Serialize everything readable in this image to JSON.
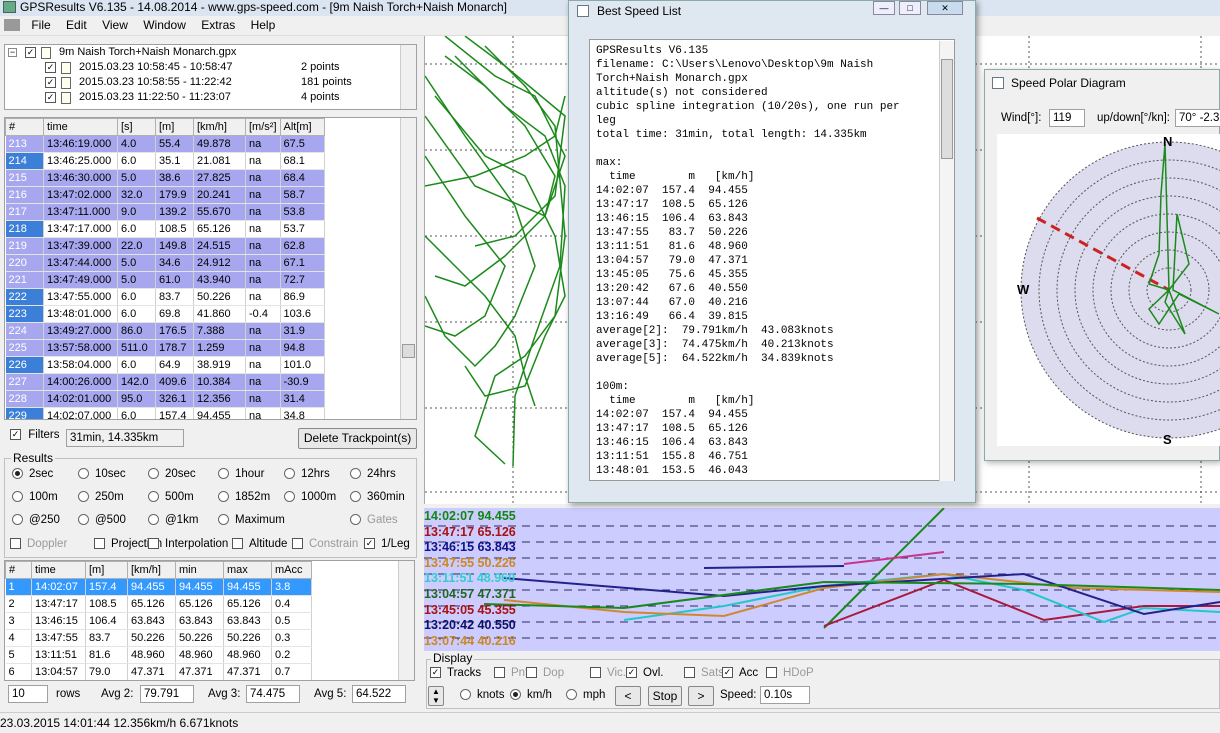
{
  "app": {
    "title": "GPSResults V6.135 - 14.08.2014 - www.gps-speed.com - [9m Naish Torch+Naish Monarch]",
    "menu": [
      "File",
      "Edit",
      "View",
      "Window",
      "Extras",
      "Help"
    ]
  },
  "filetree": {
    "root": "9m Naish Torch+Naish Monarch.gpx",
    "items": [
      {
        "label": "2015.03.23 10:58:45 - 10:58:47",
        "count": "2 points"
      },
      {
        "label": "2015.03.23 10:58:55 - 11:22:42",
        "count": "181 points"
      },
      {
        "label": "2015.03.23 11:22:50 - 11:23:07",
        "count": "4 points"
      }
    ]
  },
  "trackpoints": {
    "headers": [
      "#",
      "time",
      "[s]",
      "[m]",
      "[km/h]",
      "[m/s²]",
      "Alt[m]"
    ],
    "rows": [
      [
        "213",
        "13:46:19.000",
        "4.0",
        "55.4",
        "49.878",
        "na",
        "67.5"
      ],
      [
        "214",
        "13:46:25.000",
        "6.0",
        "35.1",
        "21.081",
        "na",
        "68.1"
      ],
      [
        "215",
        "13:46:30.000",
        "5.0",
        "38.6",
        "27.825",
        "na",
        "68.4"
      ],
      [
        "216",
        "13:47:02.000",
        "32.0",
        "179.9",
        "20.241",
        "na",
        "58.7"
      ],
      [
        "217",
        "13:47:11.000",
        "9.0",
        "139.2",
        "55.670",
        "na",
        "53.8"
      ],
      [
        "218",
        "13:47:17.000",
        "6.0",
        "108.5",
        "65.126",
        "na",
        "53.7"
      ],
      [
        "219",
        "13:47:39.000",
        "22.0",
        "149.8",
        "24.515",
        "na",
        "62.8"
      ],
      [
        "220",
        "13:47:44.000",
        "5.0",
        "34.6",
        "24.912",
        "na",
        "67.1"
      ],
      [
        "221",
        "13:47:49.000",
        "5.0",
        "61.0",
        "43.940",
        "na",
        "72.7"
      ],
      [
        "222",
        "13:47:55.000",
        "6.0",
        "83.7",
        "50.226",
        "na",
        "86.9"
      ],
      [
        "223",
        "13:48:01.000",
        "6.0",
        "69.8",
        "41.860",
        "-0.4",
        "103.6"
      ],
      [
        "224",
        "13:49:27.000",
        "86.0",
        "176.5",
        "7.388",
        "na",
        "31.9"
      ],
      [
        "225",
        "13:57:58.000",
        "511.0",
        "178.7",
        "1.259",
        "na",
        "94.8"
      ],
      [
        "226",
        "13:58:04.000",
        "6.0",
        "64.9",
        "38.919",
        "na",
        "101.0"
      ],
      [
        "227",
        "14:00:26.000",
        "142.0",
        "409.6",
        "10.384",
        "na",
        "-30.9"
      ],
      [
        "228",
        "14:02:01.000",
        "95.0",
        "326.1",
        "12.356",
        "na",
        "31.4"
      ],
      [
        "229",
        "14:02:07.000",
        "6.0",
        "157.4",
        "94.455",
        "na",
        "34.8"
      ]
    ],
    "highlighted": [
      0,
      2,
      3,
      4,
      6,
      7,
      8,
      11,
      12,
      14,
      15
    ]
  },
  "filters": {
    "label": "Filters",
    "value": "31min, 14.335km",
    "delete_button": "Delete Trackpoint(s)"
  },
  "results": {
    "title": "Results",
    "row1": [
      "2sec",
      "10sec",
      "20sec",
      "1hour",
      "12hrs",
      "24hrs"
    ],
    "row2": [
      "100m",
      "250m",
      "500m",
      "1852m",
      "1000m",
      "360min"
    ],
    "row3": [
      "@250",
      "@500",
      "@1km",
      "Maximum",
      "Gates"
    ],
    "checks": [
      "Doppler",
      "Projection",
      "Interpolation",
      "Altitude",
      "Constrain",
      "1/Leg"
    ]
  },
  "results_table": {
    "headers": [
      "#",
      "time",
      "[m]",
      "[km/h]",
      "min",
      "max",
      "mAcc"
    ],
    "rows": [
      [
        "1",
        "14:02:07",
        "157.4",
        "94.455",
        "94.455",
        "94.455",
        "3.8"
      ],
      [
        "2",
        "13:47:17",
        "108.5",
        "65.126",
        "65.126",
        "65.126",
        "0.4"
      ],
      [
        "3",
        "13:46:15",
        "106.4",
        "63.843",
        "63.843",
        "63.843",
        "0.5"
      ],
      [
        "4",
        "13:47:55",
        "83.7",
        "50.226",
        "50.226",
        "50.226",
        "0.3"
      ],
      [
        "5",
        "13:11:51",
        "81.6",
        "48.960",
        "48.960",
        "48.960",
        "0.2"
      ],
      [
        "6",
        "13:04:57",
        "79.0",
        "47.371",
        "47.371",
        "47.371",
        "0.7"
      ]
    ]
  },
  "bottom": {
    "rows_value": "10",
    "rows_label": "rows",
    "avg2_label": "Avg 2:",
    "avg2": "79.791",
    "avg3_label": "Avg 3:",
    "avg3": "74.475",
    "avg5_label": "Avg 5:",
    "avg5": "64.522"
  },
  "status": "23.03.2015 14:01:44 12.356km/h  6.671knots",
  "display": {
    "title": "Display",
    "checks": [
      "Tracks",
      "Pnts",
      "Dop",
      "Vic.",
      "Ovl.",
      "Sats",
      "Acc",
      "HDoP"
    ],
    "units": [
      "knots",
      "km/h",
      "mph"
    ],
    "prev": "<",
    "stop": "Stop",
    "next": ">",
    "speed_label": "Speed:",
    "speed": "0.10s"
  },
  "graph_labels": [
    {
      "text": "14:02:07 94.455",
      "color": "#118811"
    },
    {
      "text": "13:47:17 65.126",
      "color": "#aa1111"
    },
    {
      "text": "13:46:15 63.843",
      "color": "#111188"
    },
    {
      "text": "13:47:55 50.226",
      "color": "#cc8822"
    },
    {
      "text": "13:11:51 48.960",
      "color": "#33cccc"
    },
    {
      "text": "13:04:57 47.371",
      "color": "#226622"
    },
    {
      "text": "13:45:05 45.355",
      "color": "#aa1111"
    },
    {
      "text": "13:20:42 40.550",
      "color": "#111166"
    },
    {
      "text": "13:07:44 40.216",
      "color": "#cc8822"
    }
  ],
  "best_speed": {
    "title": "Best Speed List",
    "text": "GPSResults V6.135\nfilename: C:\\Users\\Lenovo\\Desktop\\9m Naish\nTorch+Naish Monarch.gpx\naltitude(s) not considered\ncubic spline integration (10/20s), one run per\nleg\ntotal time: 31min, total length: 14.335km\n\nmax:\n  time        m   [km/h]\n14:02:07  157.4  94.455\n13:47:17  108.5  65.126\n13:46:15  106.4  63.843\n13:47:55   83.7  50.226\n13:11:51   81.6  48.960\n13:04:57   79.0  47.371\n13:45:05   75.6  45.355\n13:20:42   67.6  40.550\n13:07:44   67.0  40.216\n13:16:49   66.4  39.815\naverage[2]:  79.791km/h  43.083knots\naverage[3]:  74.475km/h  40.213knots\naverage[5]:  64.522km/h  34.839knots\n\n100m:\n  time        m   [km/h]\n14:02:07  157.4  94.455\n13:47:17  108.5  65.126\n13:46:15  106.4  63.843\n13:11:51  155.8  46.751\n13:48:01  153.5  46.043"
  },
  "polar": {
    "title": "Speed Polar Diagram",
    "wind_label": "Wind[°]:",
    "wind": "119",
    "updown_label": "up/down[°/kn]:",
    "updown": "70° -2.3",
    "n": "N",
    "s": "S",
    "w": "W"
  }
}
